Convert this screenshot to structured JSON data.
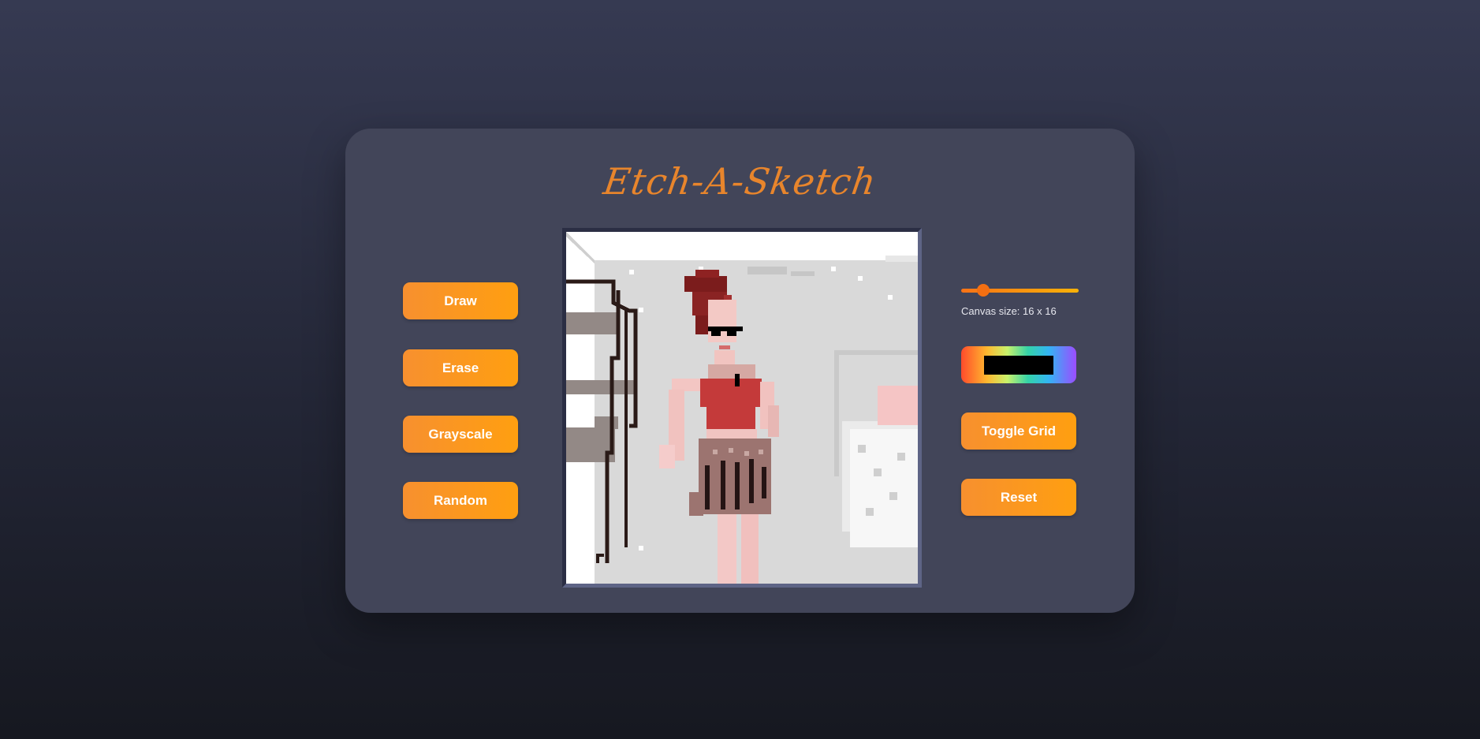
{
  "app": {
    "title": "Etch-A-Sketch",
    "accent_color": "#e8852c",
    "panel_color": "#424559"
  },
  "left_controls": {
    "draw_label": "Draw",
    "erase_label": "Erase",
    "grayscale_label": "Grayscale",
    "random_label": "Random"
  },
  "right_controls": {
    "size_slider": {
      "min": 1,
      "max": 100,
      "value": 16
    },
    "canvas_size_label": "Canvas size: 16 x 16",
    "current_color": "#000000",
    "toggle_grid_label": "Toggle Grid",
    "reset_label": "Reset"
  },
  "canvas": {
    "description_icon": "pixel-art-figure",
    "background_color": "#d9d9d9"
  }
}
